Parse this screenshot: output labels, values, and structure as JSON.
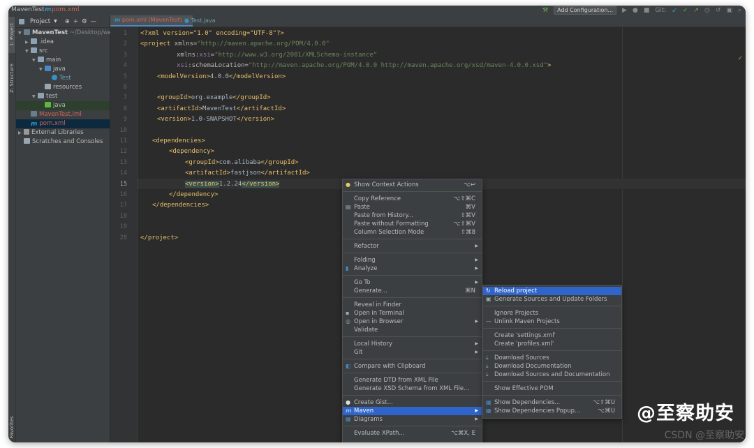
{
  "titlebar": {
    "project": "MavenTest",
    "file": "pom.xml",
    "run_config": "Add Configuration...",
    "git": "Git:"
  },
  "left_tabs": {
    "project": "1: Project",
    "structure": "Z: Structure",
    "favorites": "Favorites"
  },
  "project_panel": {
    "title": "Project",
    "tree": [
      {
        "label": "MavenTest",
        "suffix": "~/Desktop/wen/",
        "icon": "module-icon"
      },
      {
        "label": ".idea",
        "icon": "folder-icon"
      },
      {
        "label": "src",
        "icon": "folder-icon"
      },
      {
        "label": "main",
        "icon": "folder-icon"
      },
      {
        "label": "java",
        "icon": "source-folder-icon"
      },
      {
        "label": "Test",
        "icon": "class-icon"
      },
      {
        "label": "resources",
        "icon": "resources-folder-icon"
      },
      {
        "label": "test",
        "icon": "folder-icon"
      },
      {
        "label": "java",
        "icon": "test-folder-icon"
      },
      {
        "label": "MavenTest.iml",
        "icon": "iml-file-icon"
      },
      {
        "label": "pom.xml",
        "icon": "maven-file-icon"
      },
      {
        "label": "External Libraries",
        "icon": "libraries-icon"
      },
      {
        "label": "Scratches and Consoles",
        "icon": "scratches-icon"
      }
    ]
  },
  "tabs": [
    {
      "label": "pom.xml (MavenTest)",
      "active": true
    },
    {
      "label": "Test.java",
      "active": false
    }
  ],
  "editor": {
    "line_numbers": [
      "1",
      "2",
      "3",
      "4",
      "5",
      "6",
      "7",
      "8",
      "9",
      "10",
      "11",
      "12",
      "13",
      "14",
      "15",
      "16",
      "17",
      "18",
      "19",
      "28"
    ],
    "current_line": "15",
    "code": {
      "l1_decl": "<?xml version=\"1.0\" encoding=\"UTF-8\"?>",
      "l2_open": "<project",
      "l2_attr": " xmlns=",
      "l2_val": "\"http://maven.apache.org/POM/4.0.0\"",
      "l3_attr": "xmlns:",
      "l3_ns": "xsi",
      "l3_eq": "=",
      "l3_val": "\"http://www.w3.org/2001/XMLSchema-instance\"",
      "l4_ns": "xsi",
      "l4_attr": ":schemaLocation=",
      "l4_val": "\"http://maven.apache.org/POM/4.0.0 http://maven.apache.org/xsd/maven-4.0.0.xsd\"",
      "l4_close": ">",
      "model_open": "<modelVersion>",
      "model_val": "4.0.0",
      "model_close": "</modelVersion>",
      "group_open": "<groupId>",
      "group_val": "org.example",
      "group_close": "</groupId>",
      "artifact_open": "<artifactId>",
      "artifact_val": "MavenTest",
      "artifact_close": "</artifactId>",
      "version_open": "<version>",
      "version_val": "1.0-SNAPSHOT",
      "version_close": "</version>",
      "deps_open": "<dependencies>",
      "dep_open": "<dependency>",
      "dgroup_open": "<groupId>",
      "dgroup_val": "com.alibaba",
      "dgroup_close": "</groupId>",
      "dartifact_open": "<artifactId>",
      "dartifact_val": "fastjson",
      "dartifact_close": "</artifactId>",
      "dversion_open": "<version>",
      "dversion_val": "1.2.24",
      "dversion_close": "</version>",
      "dep_close": "</dependency>",
      "deps_close": "</dependencies>",
      "project_close": "</project>"
    }
  },
  "context_menu": [
    {
      "label": "Show Context Actions",
      "shortcut": "⌥↩",
      "icon": "bulb-icon"
    },
    {
      "label": "Copy Reference",
      "shortcut": "⌥⇧⌘C"
    },
    {
      "label": "Paste",
      "shortcut": "⌘V",
      "icon": "paste-icon"
    },
    {
      "label": "Paste from History...",
      "shortcut": "⇧⌘V"
    },
    {
      "label": "Paste without Formatting",
      "shortcut": "⌥⇧⌘V"
    },
    {
      "label": "Column Selection Mode",
      "shortcut": "⇧⌘8"
    },
    {
      "label": "Refactor"
    },
    {
      "label": "Folding"
    },
    {
      "label": "Analyze"
    },
    {
      "label": "Go To"
    },
    {
      "label": "Generate...",
      "shortcut": "⌘N"
    },
    {
      "label": "Reveal in Finder"
    },
    {
      "label": "Open in Terminal"
    },
    {
      "label": "Open in Browser"
    },
    {
      "label": "Validate"
    },
    {
      "label": "Local History"
    },
    {
      "label": "Git"
    },
    {
      "label": "Compare with Clipboard"
    },
    {
      "label": "Generate DTD from XML File"
    },
    {
      "label": "Generate XSD Schema from XML File..."
    },
    {
      "label": "Create Gist..."
    },
    {
      "label": "Maven"
    },
    {
      "label": "Diagrams"
    },
    {
      "label": "Evaluate XPath...",
      "shortcut": "⌥⌘X, E"
    }
  ],
  "maven_menu": [
    {
      "label": "Reload project"
    },
    {
      "label": "Generate Sources and Update Folders"
    },
    {
      "label": "Ignore Projects"
    },
    {
      "label": "Unlink Maven Projects"
    },
    {
      "label": "Create 'settings.xml'"
    },
    {
      "label": "Create 'profiles.xml'"
    },
    {
      "label": "Download Sources"
    },
    {
      "label": "Download Documentation"
    },
    {
      "label": "Download Sources and Documentation"
    },
    {
      "label": "Show Effective POM"
    },
    {
      "label": "Show Dependencies...",
      "shortcut": "⌥⇧⌘U"
    },
    {
      "label": "Show Dependencies Popup...",
      "shortcut": "⌥⌘U"
    }
  ],
  "watermark": {
    "text": "@至察助安",
    "csdn": "CSDN @至察助安"
  }
}
